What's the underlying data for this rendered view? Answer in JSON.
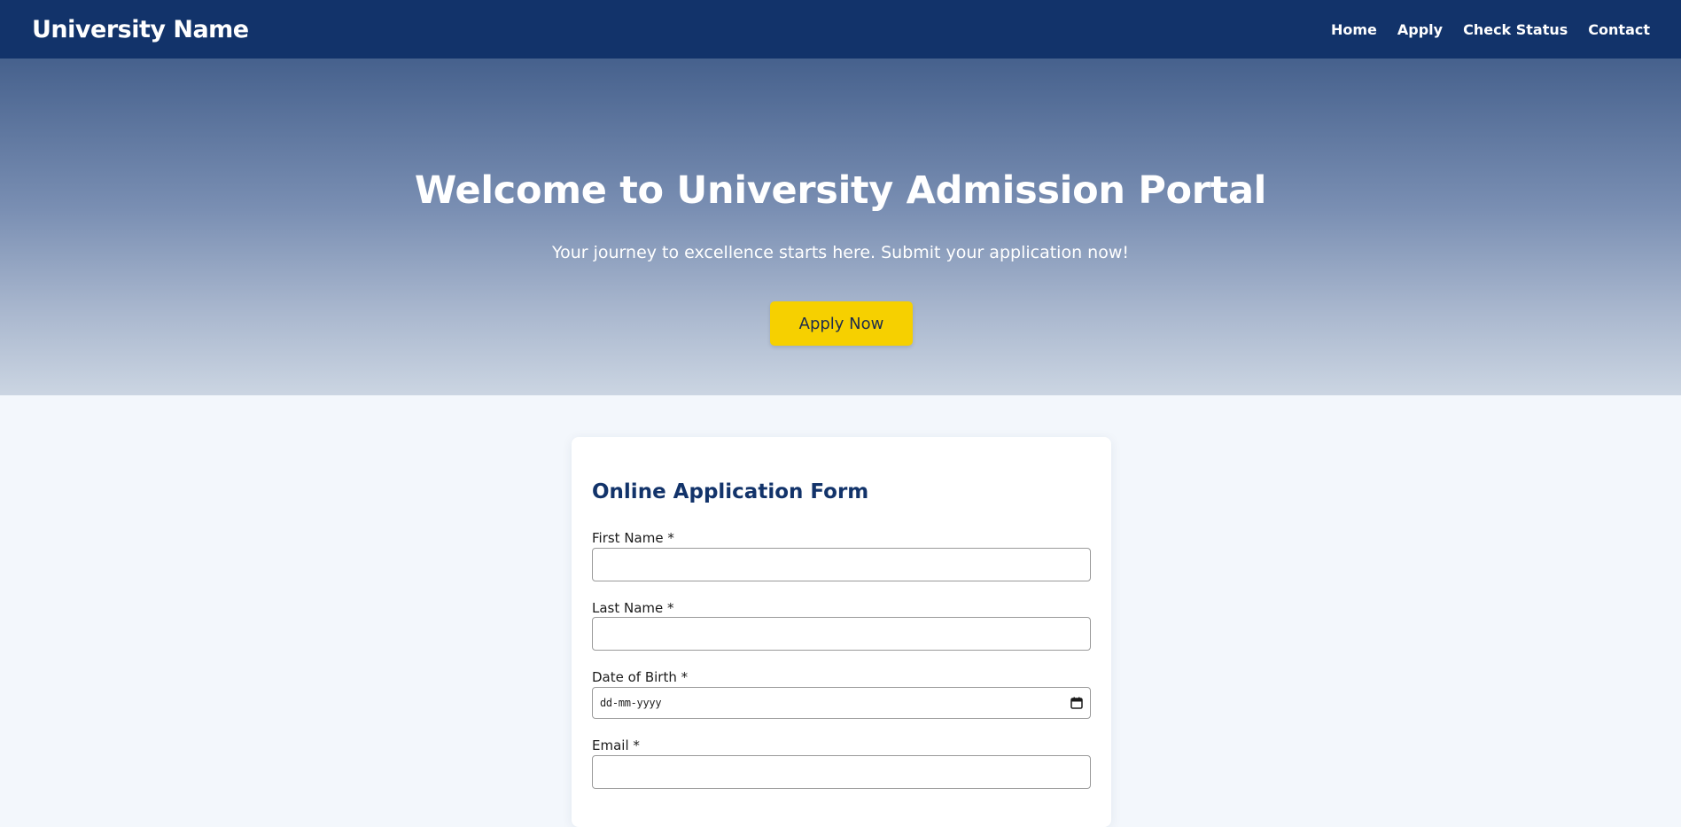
{
  "navbar": {
    "brand": "University Name",
    "links": [
      "Home",
      "Apply",
      "Check Status",
      "Contact"
    ]
  },
  "hero": {
    "title": "Welcome to University Admission Portal",
    "subtitle": "Your journey to excellence starts here. Submit your application now!",
    "cta_label": "Apply Now"
  },
  "form": {
    "title": "Online Application Form",
    "fields": [
      {
        "label": "First Name *",
        "value": ""
      },
      {
        "label": "Last Name *",
        "value": ""
      },
      {
        "label": "Date of Birth *",
        "placeholder": "dd-mm-yyyy",
        "icon": "calendar-icon"
      },
      {
        "label": "Email *",
        "value": ""
      }
    ]
  },
  "colors": {
    "navbar": "#12336a",
    "accent": "#f6d000",
    "form_title": "#12336a",
    "page_background": "#f3f7fc"
  }
}
